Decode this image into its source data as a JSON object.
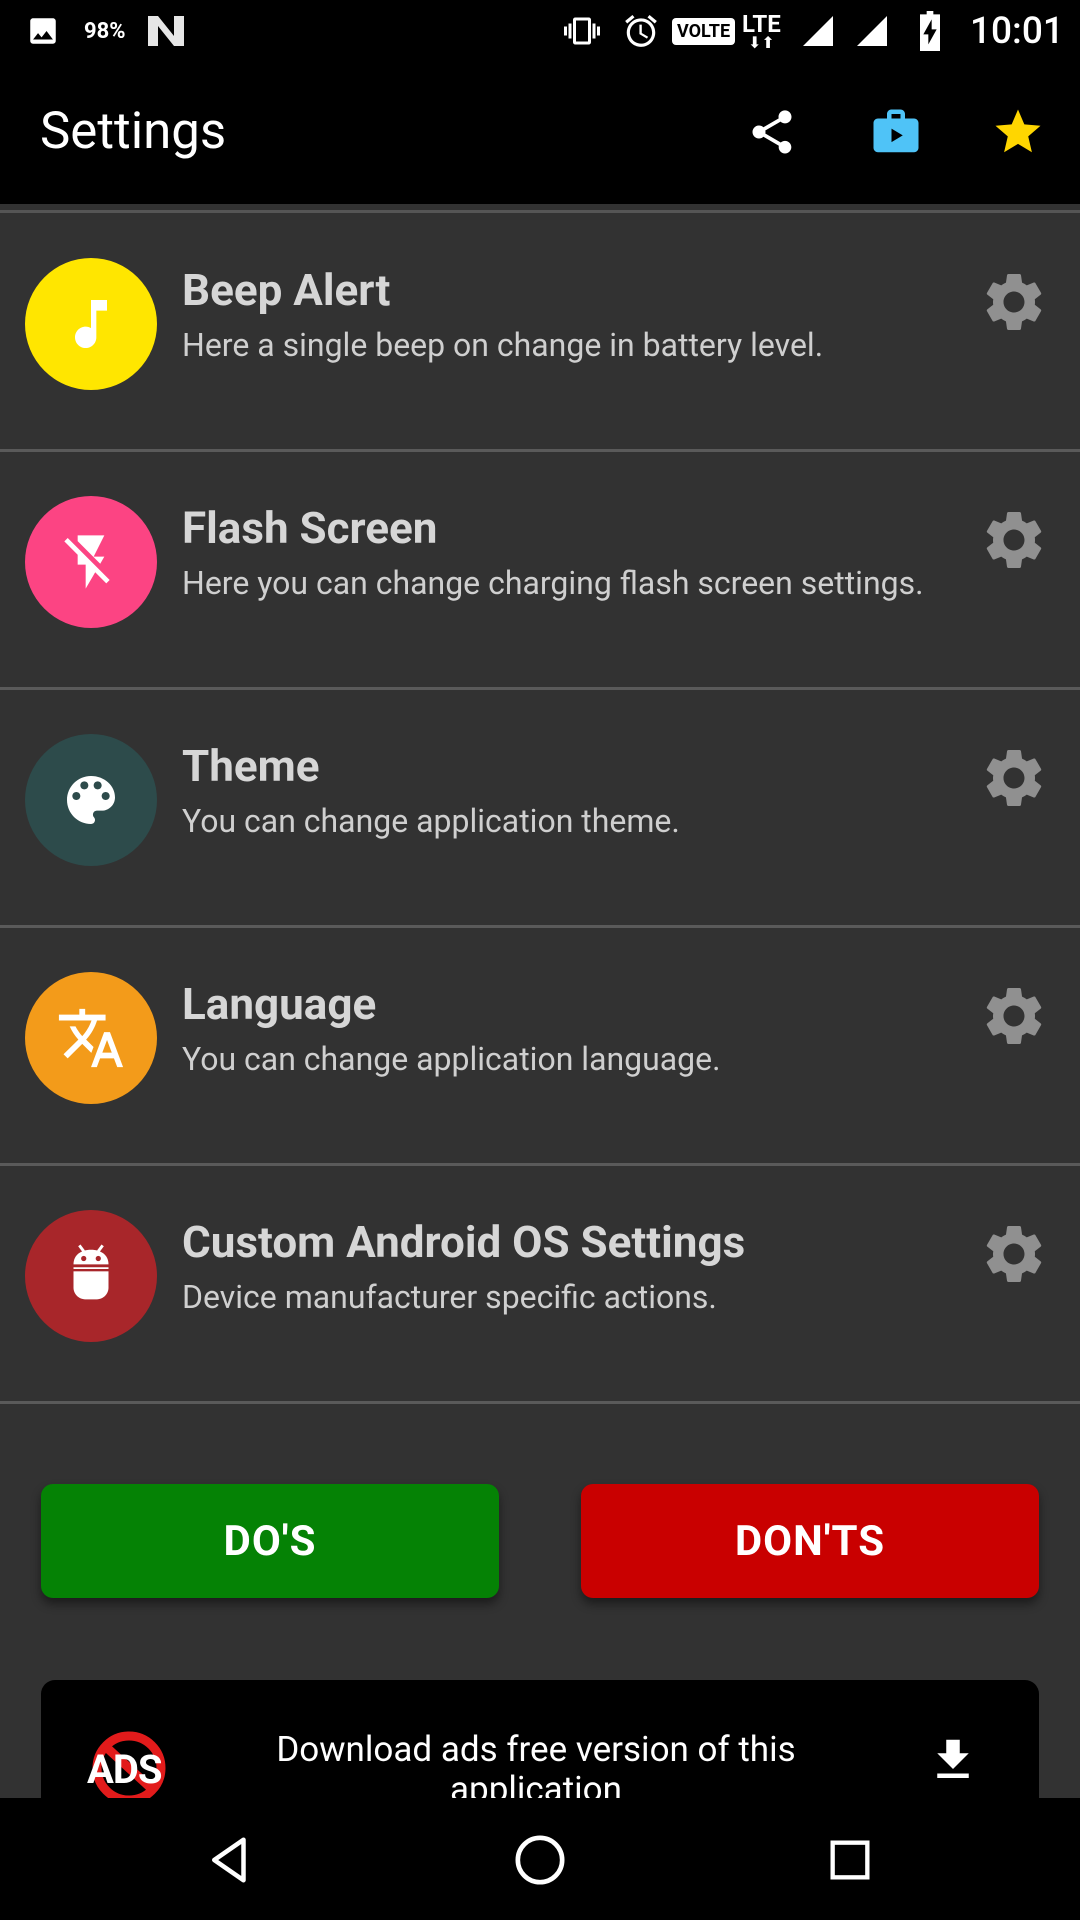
{
  "status_bar": {
    "battery_percent_text": "98%",
    "network_badge": "VOLTE",
    "network_type": "LTE",
    "time": "10:01"
  },
  "app_bar": {
    "title": "Settings",
    "actions": [
      {
        "icon": "share-icon"
      },
      {
        "icon": "play-store-bag-icon"
      },
      {
        "icon": "star-icon"
      }
    ]
  },
  "settings": [
    {
      "title": "Beep Alert",
      "description": "Here a single beep on change in battery level.",
      "icon": "music-note-icon",
      "icon_bg": "#ffe600"
    },
    {
      "title": "Flash Screen",
      "description": "Here you can change charging flash screen settings.",
      "icon": "flash-off-icon",
      "icon_bg": "#fc4483"
    },
    {
      "title": "Theme",
      "description": "You can change application theme.",
      "icon": "palette-icon",
      "icon_bg": "#2d4b4b"
    },
    {
      "title": "Language",
      "description": "You can change application language.",
      "icon": "translate-icon",
      "icon_bg": "#f39b1a"
    },
    {
      "title": "Custom Android OS Settings",
      "description": "Device manufacturer specific actions.",
      "icon": "android-icon",
      "icon_bg": "#a8262a"
    }
  ],
  "buttons": {
    "dos_label": "DO'S",
    "donts_label": "DON'TS"
  },
  "ad_banner": {
    "logo_text": "ADS",
    "text": "Download ads free version of this application"
  },
  "colors": {
    "background": "#323232",
    "dos_green": "#058205",
    "donts_red": "#c90000",
    "star_yellow": "#ffd600",
    "bag_blue": "#4fc3f7"
  }
}
